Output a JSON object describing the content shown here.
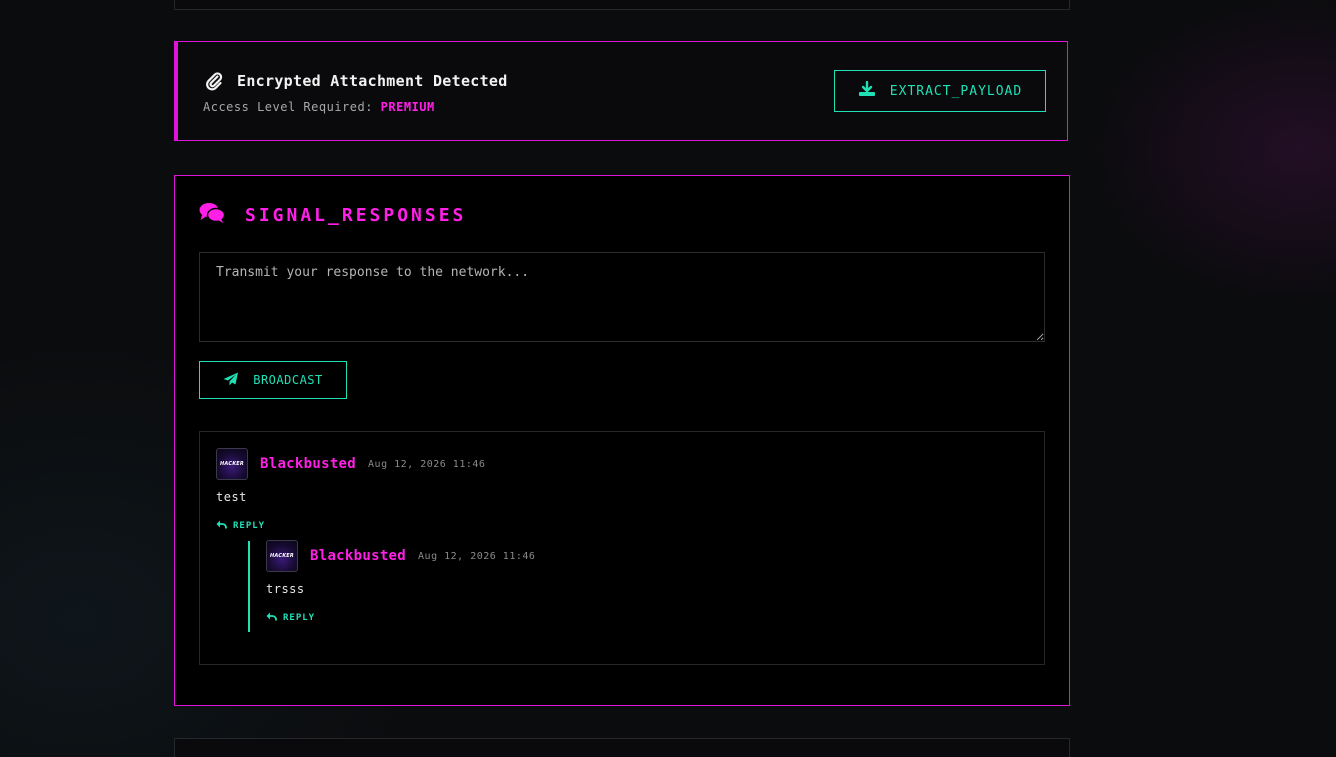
{
  "attachment": {
    "title": "Encrypted Attachment Detected",
    "access_label": "Access Level Required: ",
    "access_level": "PREMIUM",
    "extract_label": "EXTRACT_PAYLOAD",
    "icon": "paperclip-icon"
  },
  "responses": {
    "title": "SIGNAL_RESPONSES",
    "icon": "comments-icon",
    "input_placeholder": "Transmit your response to the network...",
    "broadcast_label": "BROADCAST"
  },
  "comments": [
    {
      "author": "Blackbusted",
      "timestamp": "Aug 12, 2026 11:46",
      "body": "test",
      "avatar_text": "HACKER",
      "reply_label": "REPLY",
      "replies": [
        {
          "author": "Blackbusted",
          "timestamp": "Aug 12, 2026 11:46",
          "body": "trsss",
          "avatar_text": "HACKER",
          "reply_label": "REPLY"
        }
      ]
    }
  ],
  "colors": {
    "accent_magenta": "#ff1fe6",
    "accent_teal": "#20e0b6",
    "background": "#000000"
  }
}
